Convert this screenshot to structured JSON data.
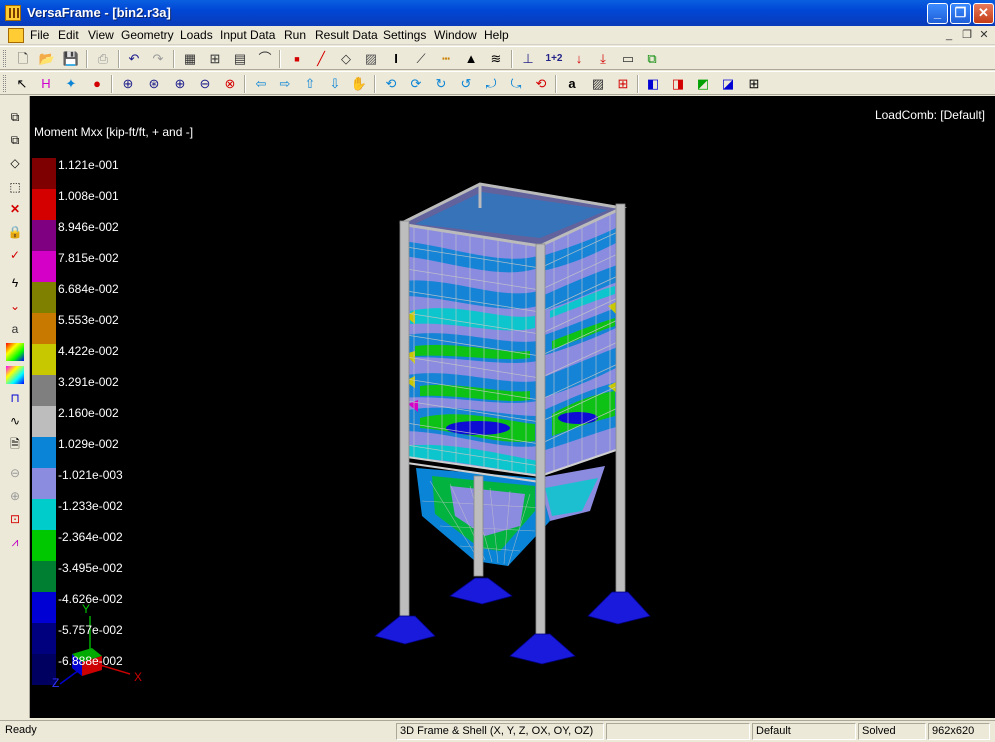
{
  "window": {
    "title": "VersaFrame - [bin2.r3a]"
  },
  "menu": {
    "items": [
      "File",
      "Edit",
      "View",
      "Geometry",
      "Loads",
      "Input Data",
      "Run",
      "Result Data",
      "Settings",
      "Window",
      "Help"
    ]
  },
  "viewport": {
    "legend_title": "Moment Mxx [kip-ft/ft, + and -]",
    "load_comb": "LoadComb: [Default]",
    "legend": [
      {
        "label": "1.121e-001",
        "color": "#7f0000"
      },
      {
        "label": "1.008e-001",
        "color": "#d40000"
      },
      {
        "label": "8.946e-002",
        "color": "#7f0080"
      },
      {
        "label": "7.815e-002",
        "color": "#d400c8"
      },
      {
        "label": "6.684e-002",
        "color": "#7f7f00"
      },
      {
        "label": "5.553e-002",
        "color": "#c87a00"
      },
      {
        "label": "4.422e-002",
        "color": "#c8c800"
      },
      {
        "label": "3.291e-002",
        "color": "#7f7f7f"
      },
      {
        "label": "2.160e-002",
        "color": "#bdbdbd"
      },
      {
        "label": "1.029e-002",
        "color": "#0a84d6"
      },
      {
        "label": "-1.021e-003",
        "color": "#8b8be0"
      },
      {
        "label": "-1.233e-002",
        "color": "#00cccc"
      },
      {
        "label": "-2.364e-002",
        "color": "#00c800"
      },
      {
        "label": "-3.495e-002",
        "color": "#007f33"
      },
      {
        "label": "-4.626e-002",
        "color": "#0000d4"
      },
      {
        "label": "-5.757e-002",
        "color": "#00007f"
      },
      {
        "label": "-6.888e-002",
        "color": "#000060"
      }
    ],
    "axis": {
      "x": "X",
      "y": "Y",
      "z": "Z"
    }
  },
  "status": {
    "ready": "Ready",
    "mode": "3D Frame & Shell (X, Y, Z, OX, OY, OZ)",
    "blank": "",
    "config": "Default",
    "state": "Solved",
    "size": "962x620"
  }
}
